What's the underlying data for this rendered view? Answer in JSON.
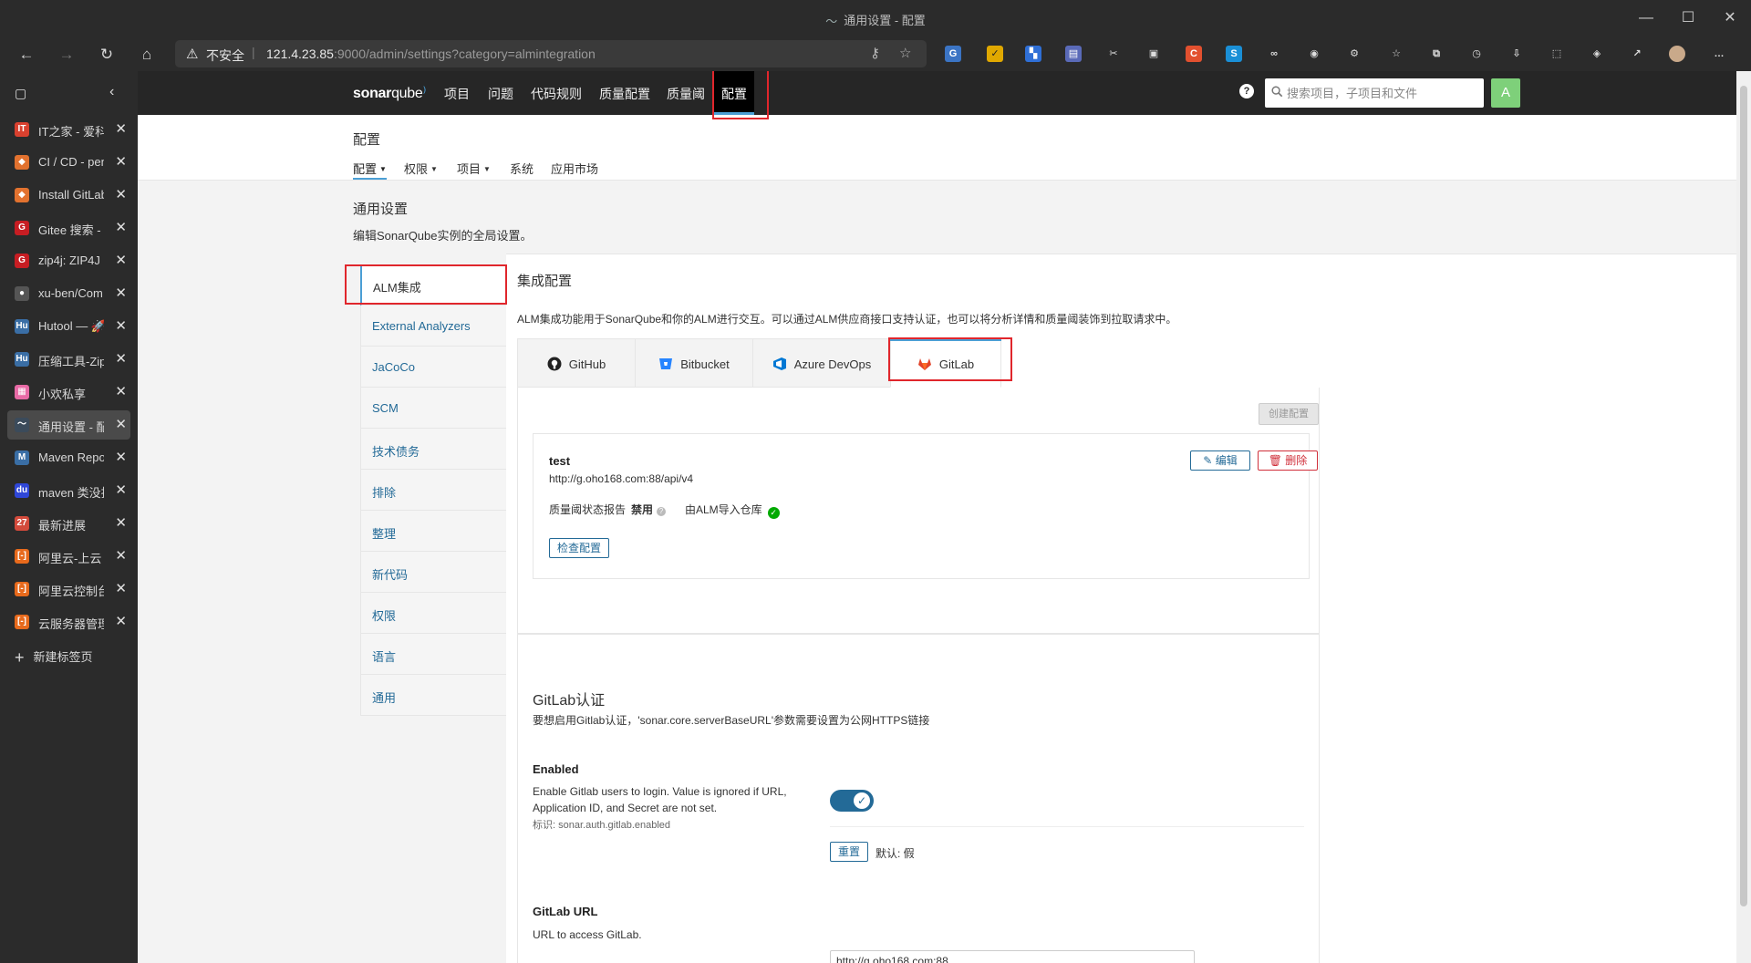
{
  "window": {
    "title": "通用设置 - 配置"
  },
  "address": {
    "insecure_label": "不安全",
    "url_host": "121.4.23.85",
    "url_rest": ":9000/admin/settings?category=almintegration"
  },
  "vertical_tabs": [
    {
      "label": "IT之家 - 爱科",
      "fav": "IT",
      "color": "#d9412f"
    },
    {
      "label": "CI / CD - pen",
      "fav": "◆",
      "color": "#e2722f"
    },
    {
      "label": "Install GitLab",
      "fav": "◆",
      "color": "#e2722f"
    },
    {
      "label": "Gitee 搜索 -",
      "fav": "G",
      "color": "#c71d23"
    },
    {
      "label": "zip4j: ZIP4J",
      "fav": "G",
      "color": "#c71d23"
    },
    {
      "label": "xu-ben/Com",
      "fav": "●",
      "color": "#555555"
    },
    {
      "label": "Hutool — 🚀",
      "fav": "Hu",
      "color": "#3a6ea5"
    },
    {
      "label": "压缩工具-Zip",
      "fav": "Hu",
      "color": "#3a6ea5"
    },
    {
      "label": "小欢私享",
      "fav": "▦",
      "color": "#e86aa6"
    },
    {
      "label": "通用设置 - 配",
      "fav": "〜",
      "color": "#3b4b5b"
    },
    {
      "label": "Maven Repo",
      "fav": "M",
      "color": "#3a6ea5"
    },
    {
      "label": "maven 类没找",
      "fav": "du",
      "color": "#2f47d8"
    },
    {
      "label": "最新进展",
      "fav": "27",
      "color": "#d34a3b"
    },
    {
      "label": "阿里云-上云",
      "fav": "[-]",
      "color": "#e86a1c"
    },
    {
      "label": "阿里云控制台",
      "fav": "[-]",
      "color": "#e86a1c"
    },
    {
      "label": "云服务器管理",
      "fav": "[-]",
      "color": "#e86a1c"
    }
  ],
  "new_tab_label": "新建标签页",
  "sonar": {
    "logo_a": "sonar",
    "logo_b": "qube",
    "nav": [
      "项目",
      "问题",
      "代码规则",
      "质量配置",
      "质量阈",
      "配置"
    ],
    "search_placeholder": "搜索项目，子项目和文件",
    "avatar_letter": "A",
    "help": "?"
  },
  "page": {
    "title": "配置",
    "tabs": [
      "配置",
      "权限",
      "项目",
      "系统",
      "应用市场"
    ]
  },
  "settings": {
    "title": "通用设置",
    "description": "编辑SonarQube实例的全局设置。",
    "menu": [
      "ALM集成",
      "External Analyzers",
      "JaCoCo",
      "SCM",
      "技术债务",
      "排除",
      "整理",
      "新代码",
      "权限",
      "语言",
      "通用"
    ]
  },
  "integration": {
    "heading": "集成配置",
    "intro": "ALM集成功能用于SonarQube和你的ALM进行交互。可以通过ALM供应商接口支持认证，也可以将分析详情和质量阈装饰到拉取请求中。",
    "tabs": [
      "GitHub",
      "Bitbucket",
      "Azure DevOps",
      "GitLab"
    ],
    "create_label": "创建配置",
    "config": {
      "name": "test",
      "url": "http://g.oho168.com:88/api/v4",
      "qg_label": "质量阈状态报告",
      "qg_value": "禁用",
      "import_label": "由ALM导入仓库",
      "check_label": "检查配置",
      "edit_label": "编辑",
      "delete_label": "删除"
    }
  },
  "gitlab_auth": {
    "heading": "GitLab认证",
    "description": "要想启用Gitlab认证，'sonar.core.serverBaseURL'参数需要设置为公网HTTPS链接",
    "enabled": {
      "label": "Enabled",
      "desc": "Enable Gitlab users to login. Value is ignored if URL, Application ID, and Secret are not set.",
      "key": "标识: sonar.auth.gitlab.enabled",
      "reset_label": "重置",
      "default_text": "默认: 假"
    },
    "url": {
      "label": "GitLab URL",
      "desc": "URL to access GitLab.",
      "value": "http://g.oho168.com:88"
    }
  },
  "colors": {
    "accent": "#4b9fd5",
    "link": "#236a97",
    "danger": "#d02f3a",
    "highlight": "#e0262c"
  }
}
